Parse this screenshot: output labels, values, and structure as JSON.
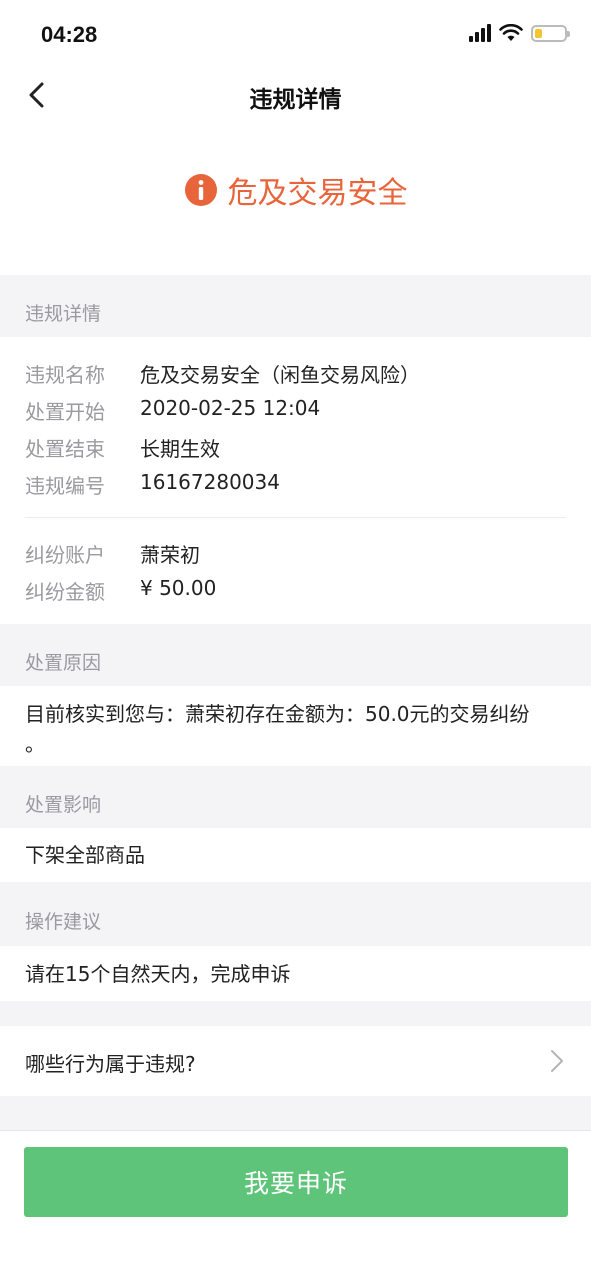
{
  "status_bar": {
    "time": "04:28"
  },
  "nav": {
    "title": "违规详情"
  },
  "hero": {
    "text": "危及交易安全",
    "color": "#e8643a"
  },
  "details": {
    "section_label": "违规详情",
    "rows": [
      {
        "key": "违规名称",
        "value": "危及交易安全（闲鱼交易风险）"
      },
      {
        "key": "处置开始",
        "value": "2020-02-25 12:04"
      },
      {
        "key": "处置结束",
        "value": "长期生效"
      },
      {
        "key": "违规编号",
        "value": "16167280034"
      }
    ],
    "dispute_rows": [
      {
        "key": "纠纷账户",
        "value": "萧荣初"
      },
      {
        "key": "纠纷金额",
        "value": "¥ 50.00"
      }
    ]
  },
  "reason": {
    "section_label": "处置原因",
    "line1": "目前核实到您与：萧荣初存在金额为：50.0元的交易纠纷",
    "line2": "。"
  },
  "impact": {
    "section_label": "处置影响",
    "text": "下架全部商品"
  },
  "advice": {
    "section_label": "操作建议",
    "text": "请在15个自然天内，完成申诉"
  },
  "help_link": {
    "label": "哪些行为属于违规?"
  },
  "appeal_button": {
    "label": "我要申诉",
    "color": "#5ec47a"
  }
}
